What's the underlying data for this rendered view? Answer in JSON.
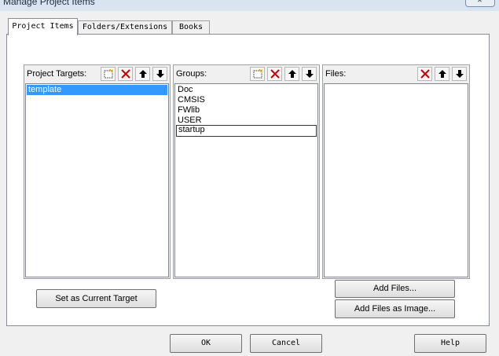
{
  "window": {
    "title": "Manage Project Items"
  },
  "tabs": [
    {
      "label": "Project Items",
      "active": true
    },
    {
      "label": "Folders/Extensions",
      "active": false
    },
    {
      "label": "Books",
      "active": false
    }
  ],
  "targets": {
    "label": "Project Targets:",
    "items": [
      "template"
    ],
    "selected": "template"
  },
  "groups": {
    "label": "Groups:",
    "items": [
      "Doc",
      "CMSIS",
      "FWlib",
      "USER",
      "startup"
    ],
    "focused": "startup"
  },
  "files": {
    "label": "Files:",
    "items": []
  },
  "buttons": {
    "set_current_target": "Set as Current Target",
    "add_files": "Add Files...",
    "add_files_image": "Add Files as Image...",
    "ok": "OK",
    "cancel": "Cancel",
    "help": "Help"
  },
  "colors": {
    "selection": "#3399ff",
    "delete_icon": "#cc0000"
  }
}
